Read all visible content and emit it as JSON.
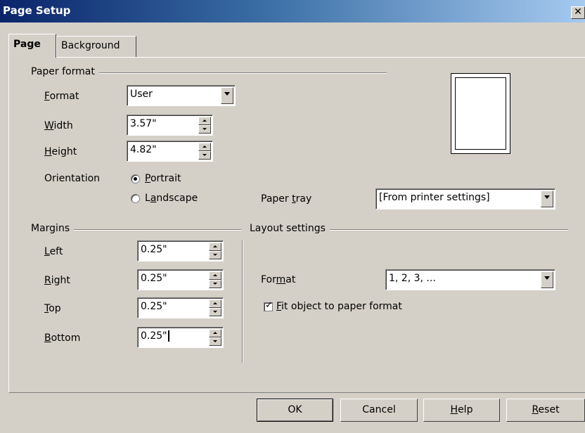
{
  "window": {
    "title": "Page Setup",
    "close_glyph": "✕"
  },
  "tabs": [
    {
      "label": "Page",
      "active": true
    },
    {
      "label": "Background",
      "active": false
    }
  ],
  "paper_format": {
    "group_label": "Paper format",
    "format_label": "Format",
    "format_value": "User",
    "width_label": "Width",
    "width_value": "3.57\"",
    "height_label": "Height",
    "height_value": "4.82\"",
    "orientation_label": "Orientation",
    "portrait_label": "Portrait",
    "landscape_label": "Landscape",
    "orientation_selected": "Portrait",
    "paper_tray_label": "Paper tray",
    "paper_tray_value": "[From printer settings]"
  },
  "margins": {
    "group_label": "Margins",
    "left_label": "Left",
    "left_value": "0.25\"",
    "right_label": "Right",
    "right_value": "0.25\"",
    "top_label": "Top",
    "top_value": "0.25\"",
    "bottom_label": "Bottom",
    "bottom_value": "0.25\""
  },
  "layout_settings": {
    "group_label": "Layout settings",
    "format_label": "Format",
    "format_value": "1, 2, 3, ...",
    "fit_label": "Fit object to paper format",
    "fit_checked": true
  },
  "buttons": {
    "ok": "OK",
    "cancel": "Cancel",
    "help": "Help",
    "reset": "Reset"
  },
  "colors": {
    "dialog_bg": "#d4d0c8",
    "title_bar_start": "#0a246a",
    "title_bar_end": "#a6caf0"
  }
}
